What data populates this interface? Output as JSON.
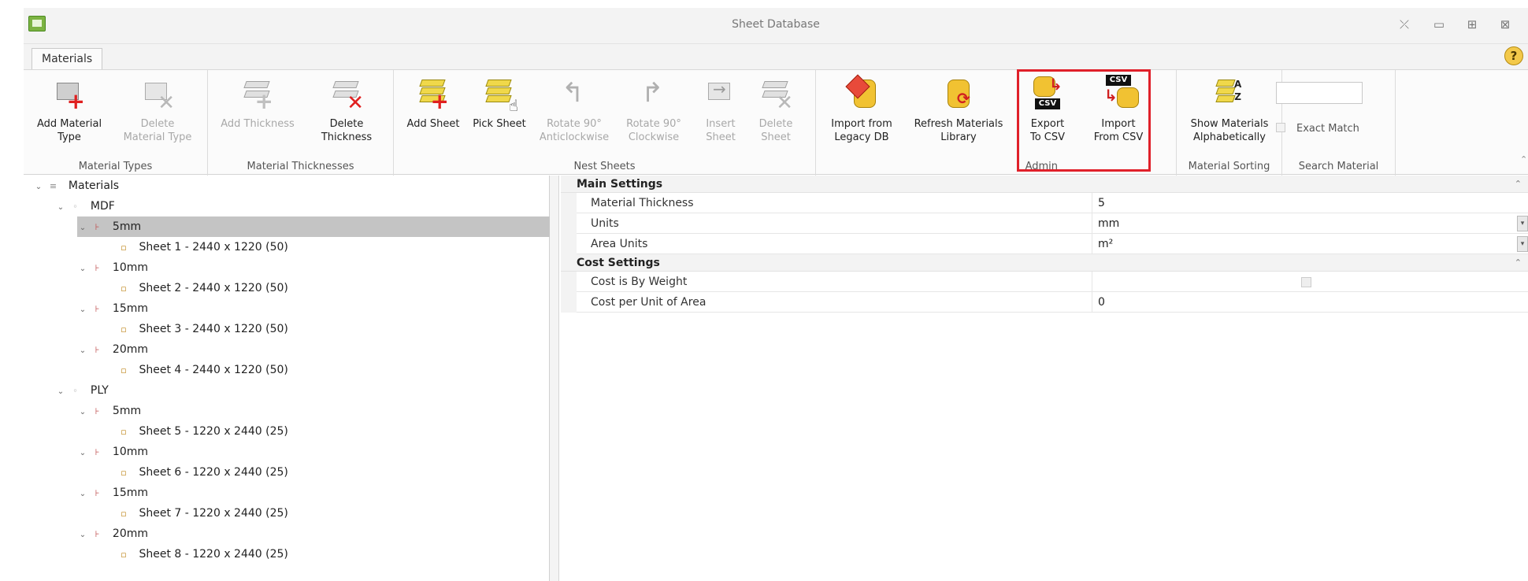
{
  "window": {
    "title": "Sheet Database",
    "controls": {
      "pin": "⤫",
      "minimize": "▭",
      "maximize": "⊞",
      "close": "⊠"
    }
  },
  "tabs": {
    "materials": "Materials",
    "help": "?"
  },
  "ribbon": {
    "material_types": {
      "label": "Material Types",
      "add": "Add Material\nType",
      "delete": "Delete\nMaterial Type"
    },
    "material_thicknesses": {
      "label": "Material Thicknesses",
      "add": "Add Thickness",
      "delete": "Delete\nThickness"
    },
    "nest_sheets": {
      "label": "Nest Sheets",
      "add_sheet": "Add Sheet",
      "pick_sheet": "Pick Sheet",
      "rotate_anticlockwise": "Rotate 90°\nAnticlockwise",
      "rotate_clockwise": "Rotate 90°\nClockwise",
      "insert_sheet": "Insert\nSheet",
      "delete_sheet": "Delete\nSheet"
    },
    "admin": {
      "label": "Admin",
      "import_legacy": "Import from\nLegacy DB",
      "refresh": "Refresh Materials\nLibrary",
      "export_csv": "Export\nTo CSV",
      "import_csv": "Import\nFrom CSV",
      "csv_tag": "CSV"
    },
    "material_sorting": {
      "label": "Material Sorting",
      "show_alpha": "Show Materials\nAlphabetically",
      "az": "A\nZ"
    },
    "search_material": {
      "label": "Search Material",
      "exact_match": "Exact Match",
      "search_value": ""
    }
  },
  "tree": {
    "root": "Materials",
    "mdf": {
      "label": "MDF",
      "t5": "5mm",
      "s1": "Sheet 1 - 2440 x 1220 (50)",
      "t10": "10mm",
      "s2": "Sheet 2 - 2440 x 1220 (50)",
      "t15": "15mm",
      "s3": "Sheet 3 - 2440 x 1220 (50)",
      "t20": "20mm",
      "s4": "Sheet 4 - 2440 x 1220 (50)"
    },
    "ply": {
      "label": "PLY",
      "t5": "5mm",
      "s5": "Sheet 5 - 1220 x 2440 (25)",
      "t10": "10mm",
      "s6": "Sheet 6 - 1220 x 2440 (25)",
      "t15": "15mm",
      "s7": "Sheet 7 - 1220 x 2440 (25)",
      "t20": "20mm",
      "s8": "Sheet 8 - 1220 x 2440 (25)"
    }
  },
  "properties": {
    "main": {
      "title": "Main Settings",
      "thickness_label": "Material Thickness",
      "thickness_value": "5",
      "units_label": "Units",
      "units_value": "mm",
      "area_label": "Area Units",
      "area_value": "m²"
    },
    "cost": {
      "title": "Cost Settings",
      "by_weight_label": "Cost is By Weight",
      "per_area_label": "Cost per Unit of Area",
      "per_area_value": "0"
    }
  },
  "colors": {
    "highlight": "#e0202a",
    "selection": "#c4c4c4",
    "accent": "#f1c232"
  }
}
